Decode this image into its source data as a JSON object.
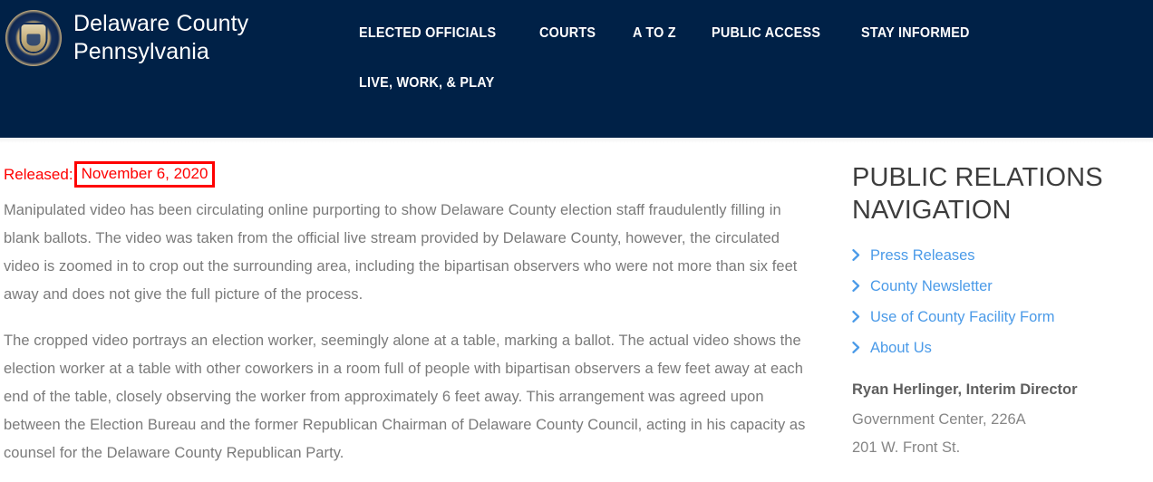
{
  "header": {
    "logo_icon": "county-seal-icon",
    "brand_name": "Delaware County\nPennsylvania",
    "nav_row_1": [
      {
        "label": "ELECTED OFFICIALS"
      },
      {
        "label": "COURTS"
      },
      {
        "label": "A TO Z"
      },
      {
        "label": "PUBLIC ACCESS"
      },
      {
        "label": "STAY INFORMED"
      }
    ],
    "nav_row_2": [
      {
        "label": "LIVE, WORK, & PLAY"
      }
    ],
    "background_color": "#002147"
  },
  "article": {
    "released_label": "Released:",
    "released_date": "November 6, 2020",
    "highlight_color": "#ff0000",
    "paragraphs": [
      "Manipulated video has been circulating online purporting to show Delaware County election staff fraudulently filling in blank ballots. The video was taken from the official live stream provided by Delaware County, however, the circulated video is zoomed in to crop out the surrounding area, including the bipartisan observers who were not more than six feet away and does not give the full picture of the process.",
      "The cropped video portrays an election worker, seemingly alone at a table, marking a ballot. The actual video shows the election worker at a table with other coworkers in a room full of people with bipartisan observers a few feet away at each end of the table, closely observing the worker from approximately 6 feet away. This arrangement was agreed upon between the Election Bureau and the former Republican Chairman of Delaware County Council, acting in his capacity as counsel for the Delaware County Republican Party."
    ]
  },
  "sidebar": {
    "title": "PUBLIC RELATIONS NAVIGATION",
    "link_color": "#4a9ae8",
    "links": [
      {
        "label": "Press Releases",
        "icon": "chevron-right-icon"
      },
      {
        "label": "County Newsletter",
        "icon": "chevron-right-icon"
      },
      {
        "label": "Use of County Facility Form",
        "icon": "chevron-right-icon"
      },
      {
        "label": "About Us",
        "icon": "chevron-right-icon"
      }
    ],
    "contact": {
      "name": "Ryan Herlinger, Interim Director",
      "address_lines": [
        "Government Center, 226A",
        "201 W. Front St."
      ]
    }
  }
}
